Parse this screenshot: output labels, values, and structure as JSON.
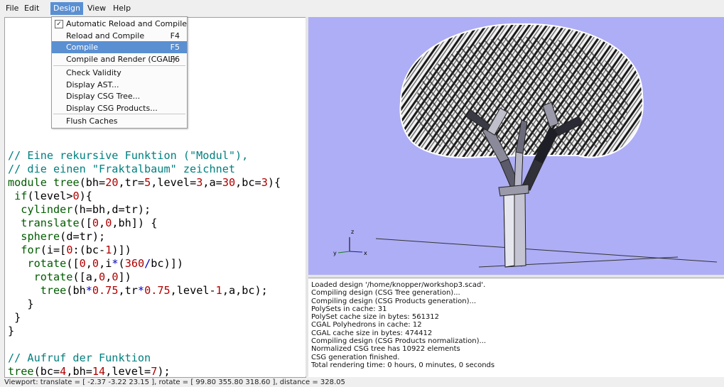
{
  "menubar": [
    "File",
    "Edit",
    "Design",
    "View",
    "Help"
  ],
  "design_menu": {
    "items": [
      {
        "label": "Automatic Reload and Compile",
        "shortcut": "",
        "checked": true
      },
      {
        "label": "Reload and Compile",
        "shortcut": "F4"
      },
      {
        "label": "Compile",
        "shortcut": "F5",
        "highlighted": true
      },
      {
        "label": "Compile and Render (CGAL)",
        "shortcut": "F6"
      },
      {
        "label": "Check Validity",
        "shortcut": ""
      },
      {
        "label": "Display AST...",
        "shortcut": ""
      },
      {
        "label": "Display CSG Tree...",
        "shortcut": ""
      },
      {
        "label": "Display CSG Products...",
        "shortcut": ""
      },
      {
        "label": "Flush Caches",
        "shortcut": ""
      }
    ]
  },
  "editor": {
    "lines": [
      "// Eine rekursive Funktion (\"Modul\"),",
      "// die einen \"Fraktalbaum\" zeichnet",
      "module tree(bh=20,tr=5,level=3,a=30,bc=3){",
      " if(level>0){",
      "  cylinder(h=bh,d=tr);",
      "  translate([0,0,bh]) {",
      "  sphere(d=tr);",
      "  for(i=[0:(bc-1)])",
      "   rotate([0,0,i*(360/bc)])",
      "    rotate([a,0,0])",
      "     tree(bh*0.75,tr*0.75,level-1,a,bc);",
      "   }",
      " }",
      "}",
      "",
      "// Aufruf der Funktion",
      "tree(bc=4,bh=14,level=7);"
    ]
  },
  "console": {
    "lines": [
      "Loaded design '/home/knopper/workshop3.scad'.",
      "Compiling design (CSG Tree generation)...",
      "Compiling design (CSG Products generation)...",
      "PolySets in cache: 31",
      "PolySet cache size in bytes: 561312",
      "CGAL Polyhedrons in cache: 12",
      "CGAL cache size in bytes: 474412",
      "Compiling design (CSG Products normalization)...",
      "Normalized CSG tree has 10922 elements",
      "CSG generation finished.",
      "Total rendering time: 0 hours, 0 minutes, 0 seconds"
    ]
  },
  "axes": {
    "x": "x",
    "y": "y",
    "z": "z"
  },
  "status": "Viewport: translate = [ -2.37 -3.22 23.15 ], rotate = [ 99.80 355.80 318.60 ], distance = 328.05",
  "colors": {
    "viewport_bg": "#aeaef6",
    "menu_highlight": "#5a8fd2"
  }
}
